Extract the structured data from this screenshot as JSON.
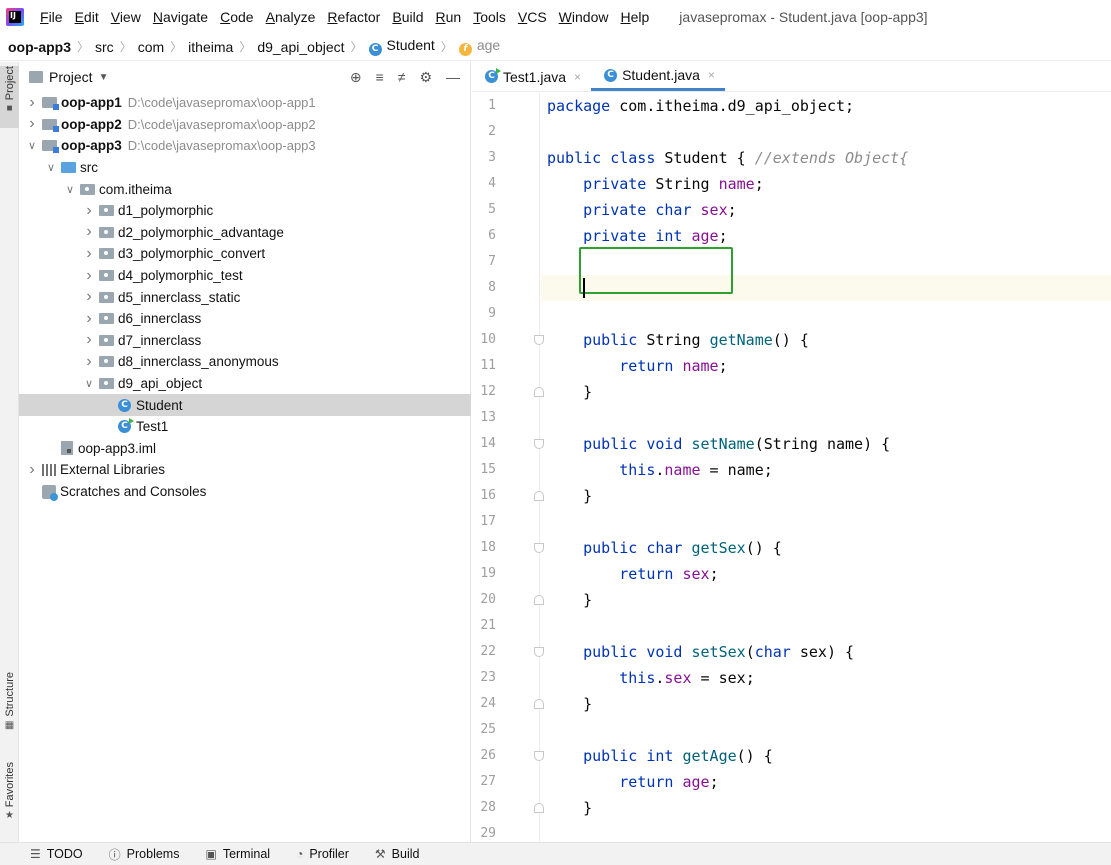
{
  "menu": {
    "logo_text": "IJ",
    "items": [
      "File",
      "Edit",
      "View",
      "Navigate",
      "Code",
      "Analyze",
      "Refactor",
      "Build",
      "Run",
      "Tools",
      "VCS",
      "Window",
      "Help"
    ],
    "window_title": "javasepromax - Student.java [oop-app3]"
  },
  "breadcrumb": {
    "items": [
      "oop-app3",
      "src",
      "com",
      "itheima",
      "d9_api_object",
      "Student",
      "age"
    ]
  },
  "left_stripe": {
    "project": "Project",
    "structure": "Structure",
    "favorites": "Favorites"
  },
  "project_panel": {
    "title": "Project",
    "tree": [
      {
        "name": "oop-app1",
        "path": "D:\\code\\javasepromax\\oop-app1",
        "type": "module",
        "depth": 0,
        "arrow": "right"
      },
      {
        "name": "oop-app2",
        "path": "D:\\code\\javasepromax\\oop-app2",
        "type": "module",
        "depth": 0,
        "arrow": "right"
      },
      {
        "name": "oop-app3",
        "path": "D:\\code\\javasepromax\\oop-app3",
        "type": "module",
        "depth": 0,
        "arrow": "down"
      },
      {
        "name": "src",
        "type": "src",
        "depth": 1,
        "arrow": "down"
      },
      {
        "name": "com.itheima",
        "type": "package",
        "depth": 2,
        "arrow": "down"
      },
      {
        "name": "d1_polymorphic",
        "type": "package",
        "depth": 3,
        "arrow": "right"
      },
      {
        "name": "d2_polymorphic_advantage",
        "type": "package",
        "depth": 3,
        "arrow": "right"
      },
      {
        "name": "d3_polymorphic_convert",
        "type": "package",
        "depth": 3,
        "arrow": "right"
      },
      {
        "name": "d4_polymorphic_test",
        "type": "package",
        "depth": 3,
        "arrow": "right"
      },
      {
        "name": "d5_innerclass_static",
        "type": "package",
        "depth": 3,
        "arrow": "right"
      },
      {
        "name": "d6_innerclass",
        "type": "package",
        "depth": 3,
        "arrow": "right"
      },
      {
        "name": "d7_innerclass",
        "type": "package",
        "depth": 3,
        "arrow": "right"
      },
      {
        "name": "d8_innerclass_anonymous",
        "type": "package",
        "depth": 3,
        "arrow": "right"
      },
      {
        "name": "d9_api_object",
        "type": "package",
        "depth": 3,
        "arrow": "down"
      },
      {
        "name": "Student",
        "type": "class",
        "depth": 4,
        "arrow": "",
        "selected": true
      },
      {
        "name": "Test1",
        "type": "class-run",
        "depth": 4,
        "arrow": ""
      },
      {
        "name": "oop-app3.iml",
        "type": "iml",
        "depth": 1,
        "arrow": ""
      },
      {
        "name": "External Libraries",
        "type": "lib",
        "depth": 0,
        "arrow": "right"
      },
      {
        "name": "Scratches and Consoles",
        "type": "scratch",
        "depth": 0,
        "arrow": ""
      }
    ]
  },
  "editor": {
    "tabs": [
      {
        "label": "Test1.java",
        "active": false
      },
      {
        "label": "Student.java",
        "active": true
      }
    ],
    "current_line": 8,
    "lines": [
      "package com.itheima.d9_api_object;",
      "",
      "public class Student { //extends Object{",
      "    private String name;",
      "    private char sex;",
      "    private int age;",
      "",
      "",
      "",
      "    public String getName() {",
      "        return name;",
      "    }",
      "",
      "    public void setName(String name) {",
      "        this.name = name;",
      "    }",
      "",
      "    public char getSex() {",
      "        return sex;",
      "    }",
      "",
      "    public void setSex(char sex) {",
      "        this.sex = sex;",
      "    }",
      "",
      "    public int getAge() {",
      "        return age;",
      "    }",
      ""
    ]
  },
  "bottom_bar": {
    "items": [
      {
        "label": "TODO",
        "icon": "list-icon"
      },
      {
        "label": "Problems",
        "icon": "problems-icon"
      },
      {
        "label": "Terminal",
        "icon": "terminal-icon"
      },
      {
        "label": "Profiler",
        "icon": "profiler-icon"
      },
      {
        "label": "Build",
        "icon": "hammer-icon"
      }
    ]
  },
  "colors": {
    "keyword": "#0033b3",
    "field": "#871094",
    "method": "#00627a",
    "comment": "#8c8c8c",
    "highlight_box": "#2ea12e",
    "selection": "#d5d5d5"
  }
}
